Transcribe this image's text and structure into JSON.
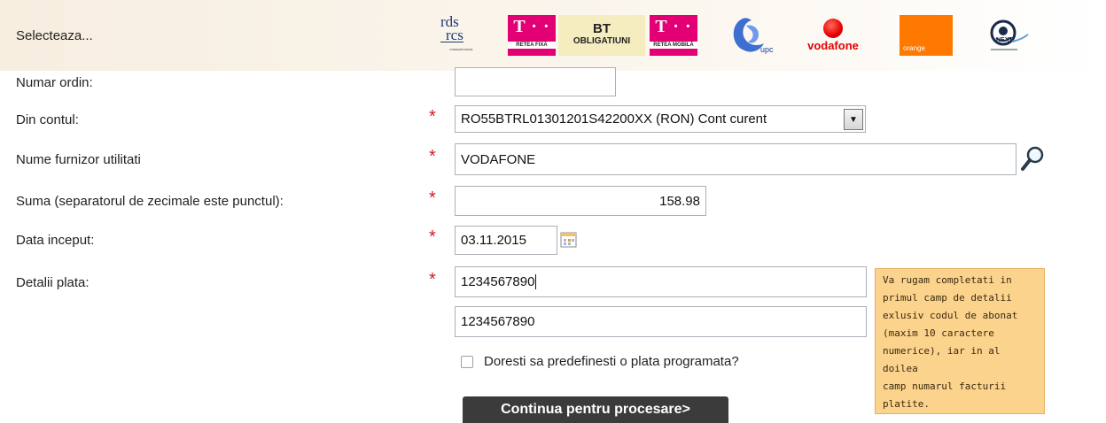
{
  "header": {
    "select_label": "Selecteaza...",
    "providers": [
      {
        "name": "rds-rcs",
        "line1": "rds",
        "line2": "rcs",
        "line3": "communications"
      },
      {
        "name": "telekom-fixa",
        "mark": "T · ·",
        "caption": "RETEA FIXĂ",
        "color": "#e20074"
      },
      {
        "name": "bt-obligatiuni",
        "line1": "BT",
        "line2": "OBLIGATIUNI"
      },
      {
        "name": "telekom-mobila",
        "mark": "T · ·",
        "caption": "RETEA MOBILĂ",
        "color": "#e20074"
      },
      {
        "name": "upc",
        "text": "upc"
      },
      {
        "name": "vodafone",
        "text": "vodafone",
        "color": "#e60000"
      },
      {
        "name": "orange",
        "text": "orange",
        "color": "#ff7900"
      },
      {
        "name": "nextgen",
        "text": "NEXT"
      }
    ]
  },
  "form": {
    "order_number": {
      "label": "Numar ordin:",
      "value": ""
    },
    "account": {
      "label": "Din contul:",
      "value": "RO55BTRL01301201S42200XX (RON) Cont curent"
    },
    "provider": {
      "label": "Nume furnizor utilitati",
      "value": "VODAFONE"
    },
    "amount": {
      "label": "Suma (separatorul de zecimale este punctul):",
      "value": "158.98"
    },
    "start_date": {
      "label": "Data inceput:",
      "value": "03.11.2015"
    },
    "details": {
      "label": "Detalii plata:",
      "value1": "1234567890",
      "value2": "1234567890"
    },
    "required_mark": "*"
  },
  "tooltip": {
    "lines": [
      "Va rugam completati in",
      "primul camp de detalii",
      "exlusiv codul de abonat",
      "(maxim 10 caractere",
      "numerice), iar in al doilea",
      "camp numarul facturii",
      "platite."
    ]
  },
  "checkbox": {
    "label": "Doresti sa predefinesti o plata programata?",
    "checked": false
  },
  "submit_label": "Continua pentru procesare>",
  "colors": {
    "required": "#d71920",
    "tooltip_bg": "#fcd38d",
    "submit_bg": "#3b3b3b",
    "header_bg": "#f7eee0"
  }
}
